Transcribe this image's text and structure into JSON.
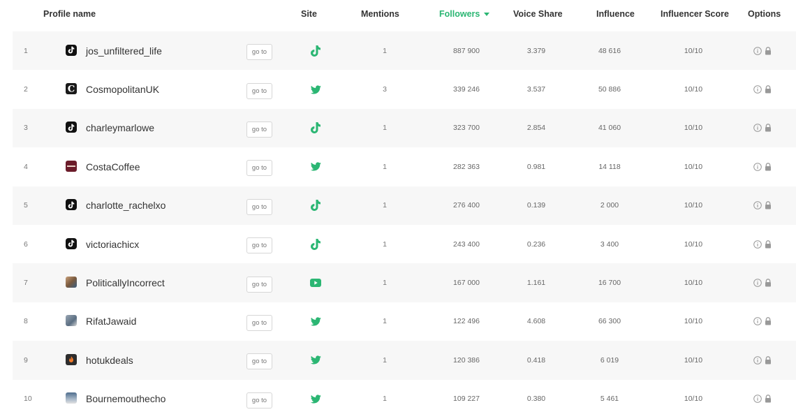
{
  "header": {
    "profile_name": "Profile name",
    "site": "Site",
    "mentions": "Mentions",
    "followers": "Followers",
    "voice_share": "Voice Share",
    "influence": "Influence",
    "influencer_score": "Influencer Score",
    "options": "Options"
  },
  "goto_label": "go to",
  "colors": {
    "accent": "#2bb673",
    "row_alt": "#f7f7f7"
  },
  "rows": [
    {
      "num": "1",
      "name": "jos_unfiltered_life",
      "avatar": "tiktok-avatar-icon",
      "site": "tiktok-icon",
      "mentions": "1",
      "followers": "887 900",
      "voice_share": "3.379",
      "influence": "48 616",
      "score": "10/10"
    },
    {
      "num": "2",
      "name": "CosmopolitanUK",
      "avatar": "cosmopolitan-avatar-icon",
      "site": "twitter-icon",
      "mentions": "3",
      "followers": "339 246",
      "voice_share": "3.537",
      "influence": "50 886",
      "score": "10/10"
    },
    {
      "num": "3",
      "name": "charleymarlowe",
      "avatar": "tiktok-avatar-icon",
      "site": "tiktok-icon",
      "mentions": "1",
      "followers": "323 700",
      "voice_share": "2.854",
      "influence": "41 060",
      "score": "10/10"
    },
    {
      "num": "4",
      "name": "CostaCoffee",
      "avatar": "costa-avatar-icon",
      "site": "twitter-icon",
      "mentions": "1",
      "followers": "282 363",
      "voice_share": "0.981",
      "influence": "14 118",
      "score": "10/10"
    },
    {
      "num": "5",
      "name": "charlotte_rachelxo",
      "avatar": "tiktok-avatar-icon",
      "site": "tiktok-icon",
      "mentions": "1",
      "followers": "276 400",
      "voice_share": "0.139",
      "influence": "2 000",
      "score": "10/10"
    },
    {
      "num": "6",
      "name": "victoriachicx",
      "avatar": "tiktok-avatar-icon",
      "site": "tiktok-icon",
      "mentions": "1",
      "followers": "243 400",
      "voice_share": "0.236",
      "influence": "3 400",
      "score": "10/10"
    },
    {
      "num": "7",
      "name": "PoliticallyIncorrect",
      "avatar": "politically-avatar-icon",
      "site": "youtube-icon",
      "mentions": "1",
      "followers": "167 000",
      "voice_share": "1.161",
      "influence": "16 700",
      "score": "10/10"
    },
    {
      "num": "8",
      "name": "RifatJawaid",
      "avatar": "rifat-avatar-icon",
      "site": "twitter-icon",
      "mentions": "1",
      "followers": "122 496",
      "voice_share": "4.608",
      "influence": "66 300",
      "score": "10/10"
    },
    {
      "num": "9",
      "name": "hotukdeals",
      "avatar": "hotukdeals-avatar-icon",
      "site": "twitter-icon",
      "mentions": "1",
      "followers": "120 386",
      "voice_share": "0.418",
      "influence": "6 019",
      "score": "10/10"
    },
    {
      "num": "10",
      "name": "Bournemouthecho",
      "avatar": "bournemouth-avatar-icon",
      "site": "twitter-icon",
      "mentions": "1",
      "followers": "109 227",
      "voice_share": "0.380",
      "influence": "5 461",
      "score": "10/10"
    }
  ]
}
